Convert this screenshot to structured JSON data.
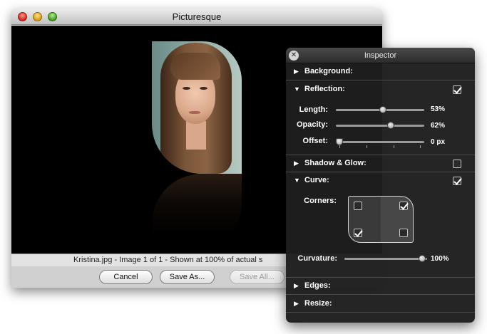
{
  "window": {
    "title": "Picturesque",
    "status_text": "Kristina.jpg - Image 1 of 1 -  Shown at 100% of actual s",
    "buttons": {
      "cancel": "Cancel",
      "save_as": "Save As...",
      "save_all": "Save All..."
    }
  },
  "inspector": {
    "title": "Inspector",
    "sections": {
      "background": {
        "label": "Background:",
        "expanded": false
      },
      "reflection": {
        "label": "Reflection:",
        "expanded": true,
        "enabled": true,
        "length": {
          "label": "Length:",
          "value": "53%",
          "level": 0.53
        },
        "opacity": {
          "label": "Opacity:",
          "value": "62%",
          "level": 0.62
        },
        "offset": {
          "label": "Offset:",
          "value": "0 px",
          "level": 0.0
        }
      },
      "shadow_glow": {
        "label": "Shadow & Glow:",
        "expanded": false,
        "enabled": false
      },
      "curve": {
        "label": "Curve:",
        "expanded": true,
        "enabled": true,
        "corners_label": "Corners:",
        "corners": {
          "top_left": false,
          "top_right": true,
          "bottom_left": true,
          "bottom_right": false
        },
        "curvature": {
          "label": "Curvature:",
          "value": "100%",
          "level": 1.0
        }
      },
      "edges": {
        "label": "Edges:",
        "expanded": false
      },
      "resize": {
        "label": "Resize:",
        "expanded": false
      }
    }
  },
  "icons": {
    "close": "close-icon",
    "minimize": "minimize-icon",
    "zoom": "zoom-icon",
    "disclosure_collapsed": "▶",
    "disclosure_expanded": "▼"
  }
}
